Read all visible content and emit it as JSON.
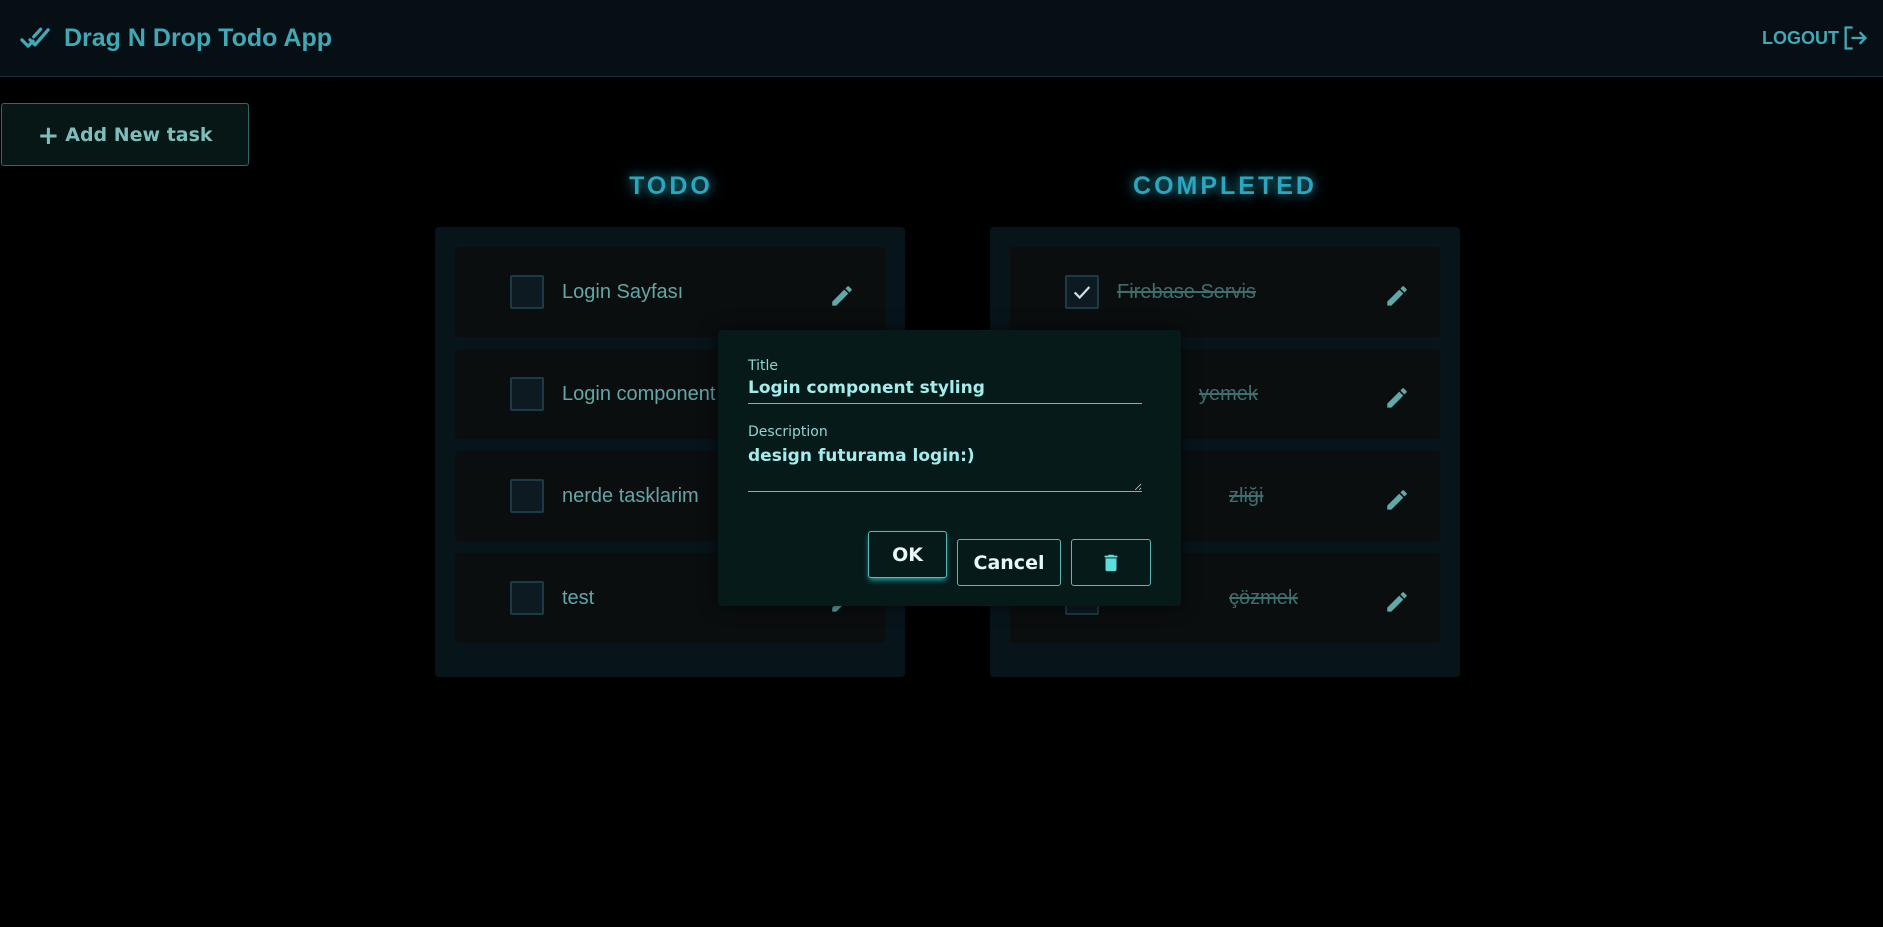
{
  "header": {
    "title": "Drag N Drop Todo App",
    "brand_icon": "check-double-icon",
    "logout_label": "LOGOUT",
    "logout_icon": "logout-icon"
  },
  "toolbar": {
    "add_label": "Add New task",
    "add_icon": "plus-icon"
  },
  "columns": {
    "todo": {
      "title": "TODO",
      "tasks": [
        {
          "title": "Login Sayfası",
          "completed": false
        },
        {
          "title": "Login component styling",
          "completed": false
        },
        {
          "title": "nerde tasklarim",
          "completed": false
        },
        {
          "title": "test",
          "completed": false
        }
      ]
    },
    "completed": {
      "title": "COMPLETED",
      "tasks": [
        {
          "title": "Firebase Servis",
          "completed": true
        },
        {
          "title": "yemek",
          "completed": true
        },
        {
          "title": "zliği",
          "completed": true
        },
        {
          "title": "çözmek",
          "completed": true
        }
      ]
    }
  },
  "dialog": {
    "title_label": "Title",
    "title_value": "Login component styling",
    "description_label": "Description",
    "description_value": "design futurama login:)",
    "ok_label": "OK",
    "cancel_label": "Cancel",
    "delete_icon": "trash-icon"
  },
  "colors": {
    "accent": "#3fa9b7",
    "background": "#000000",
    "header_bg": "#050f14",
    "panel_bg": "#07151b",
    "card_bg": "#0b0e0f",
    "dialog_bg": "#061a1a",
    "text": "#64a6a7"
  }
}
